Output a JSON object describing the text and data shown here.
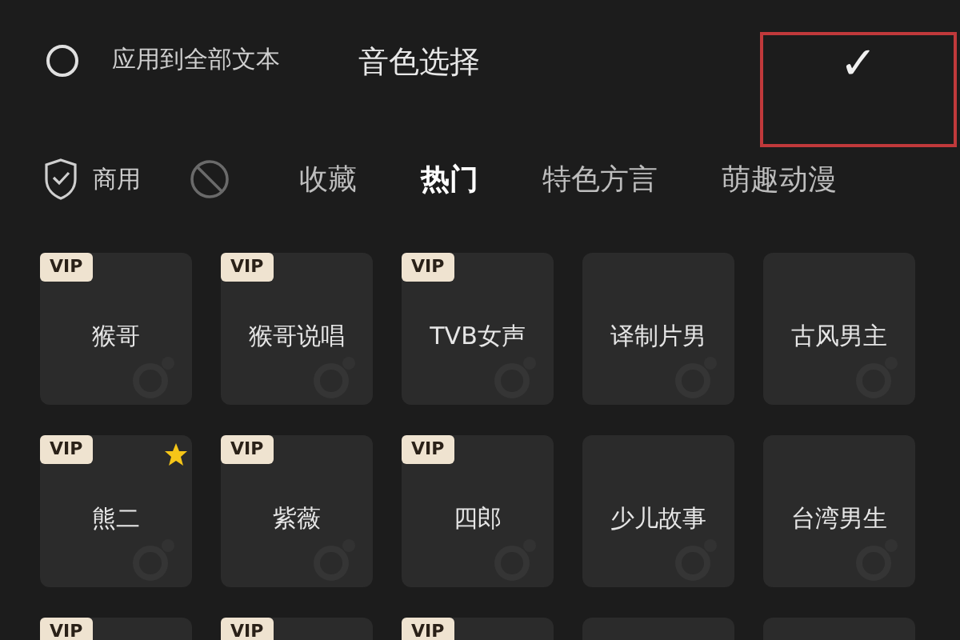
{
  "header": {
    "apply_all": {
      "label": "应用到全部文本",
      "checked": false
    },
    "title": "音色选择",
    "confirm": {
      "icon": "✓"
    }
  },
  "tabs": [
    {
      "kind": "commercial",
      "label": "商用",
      "selected": false
    },
    {
      "kind": "ban",
      "selected": false
    },
    {
      "kind": "text",
      "label": "收藏",
      "selected": false
    },
    {
      "kind": "text",
      "label": "热门",
      "selected": true
    },
    {
      "kind": "text",
      "label": "特色方言",
      "selected": false
    },
    {
      "kind": "text",
      "label": "萌趣动漫",
      "selected": false
    }
  ],
  "voices": [
    {
      "name": "猴哥",
      "badge": "VIP",
      "starred": false
    },
    {
      "name": "猴哥说唱",
      "badge": "VIP",
      "starred": false
    },
    {
      "name": "TVB女声",
      "badge": "VIP",
      "starred": false
    },
    {
      "name": "译制片男",
      "starred": false
    },
    {
      "name": "古风男主",
      "starred": false
    },
    {
      "name": "熊二",
      "badge": "VIP",
      "starred": true
    },
    {
      "name": "紫薇",
      "badge": "VIP",
      "starred": false
    },
    {
      "name": "四郎",
      "badge": "VIP",
      "starred": false
    },
    {
      "name": "少儿故事",
      "starred": false
    },
    {
      "name": "台湾男生",
      "starred": false
    },
    {
      "badge": "VIP",
      "starred": false
    },
    {
      "badge": "VIP",
      "starred": false
    },
    {
      "badge": "VIP",
      "starred": false
    },
    {
      "starred": false
    },
    {
      "starred": false
    }
  ]
}
